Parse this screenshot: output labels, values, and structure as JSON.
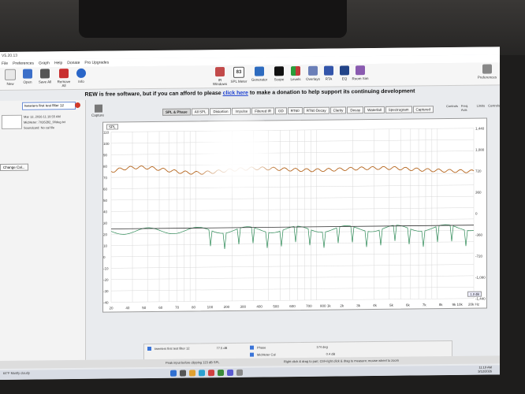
{
  "app": {
    "title": "V5.20.13",
    "menu": [
      "File",
      "Preferences",
      "Graph",
      "Help",
      "Donate",
      "Pro Upgrades"
    ]
  },
  "toolbar_left": [
    {
      "label": "New",
      "icon": "new-icon"
    },
    {
      "label": "Open",
      "icon": "folder-open-icon"
    },
    {
      "label": "Save All",
      "icon": "save-icon"
    },
    {
      "label": "Remove All",
      "icon": "remove-icon"
    },
    {
      "label": "Info",
      "icon": "info-icon"
    }
  ],
  "toolbar_center": [
    {
      "label": "IR Windows",
      "icon": "ir-windows-icon"
    },
    {
      "label": "SPL Meter",
      "icon": "spl-meter-icon",
      "value": "83"
    },
    {
      "label": "Generator",
      "icon": "generator-icon"
    },
    {
      "label": "Scope",
      "icon": "scope-icon"
    },
    {
      "label": "Levels",
      "icon": "levels-icon"
    },
    {
      "label": "Overlays",
      "icon": "overlays-icon"
    },
    {
      "label": "RTA",
      "icon": "rta-icon"
    },
    {
      "label": "EQ",
      "icon": "eq-icon"
    },
    {
      "label": "Room Sim",
      "icon": "room-sim-icon"
    }
  ],
  "preferences_label": "Preferences",
  "banner": {
    "prefix": "REW is free software, but if you can afford to please",
    "link": "click here",
    "suffix": "to make a donation to help support its continuing development"
  },
  "measurement": {
    "name": "tweeters first test filter 12",
    "date": "Mar 12, 2026 11:19:55 AM",
    "mic": "MicMeter: 7026282_90deg.txt",
    "soundcard": "Soundcard: No cal file",
    "change_cal": "Change Cal..."
  },
  "capture_label": "Capture",
  "graph_tabs": [
    "SPL & Phase",
    "All SPL",
    "Distortion",
    "Impulse",
    "Filtered IR",
    "GD",
    "RT60",
    "RT60 Decay",
    "Clarity",
    "Decay",
    "Waterfall",
    "Spectrogram",
    "Captured"
  ],
  "right_tools": [
    "Controls",
    "Freq. Axis",
    "Limits",
    "Controls"
  ],
  "plot": {
    "spl_label": "SPL",
    "y_left": [
      "110",
      "100",
      "90",
      "80",
      "70",
      "60",
      "50",
      "40",
      "30",
      "20",
      "10",
      "0",
      "-10",
      "-20",
      "-30",
      "-40"
    ],
    "y_right": [
      "1,440",
      "1,080",
      "720",
      "360",
      "0",
      "-360",
      "-720",
      "-1,080",
      "-1,440"
    ],
    "x_ticks": [
      "20",
      "40",
      "50",
      "60",
      "70",
      "80",
      "100",
      "200",
      "300",
      "400",
      "500",
      "600",
      "700",
      "800 1k",
      "2k",
      "3k",
      "4k",
      "5k",
      "6k",
      "7k",
      "8k",
      "9k 10k",
      "20k Hz"
    ],
    "readout": "1.9 dB"
  },
  "legend": [
    {
      "name": "tweeters first test filter 12",
      "value": "77.5 dB",
      "color": "#b5651d"
    },
    {
      "name": "Phase",
      "value": "174 deg",
      "color": "#2e8b57"
    },
    {
      "name": "MicMeter Cal",
      "value": "0.4 dB",
      "color": "#555555"
    }
  ],
  "status": {
    "left": "Peak input before clipping 123 dB SPL",
    "center": "Right click & drag to pan; Ctrl+right click & drag to measure; mouse wheel to zoom",
    "time": "11:19 AM",
    "date": "3/12/2026"
  },
  "taskbar_weather": "64°F Mostly cloudy",
  "colors": {
    "spl_trace": "#b5651d",
    "phase_trace": "#2e8b57",
    "link": "#1a3fd0"
  }
}
